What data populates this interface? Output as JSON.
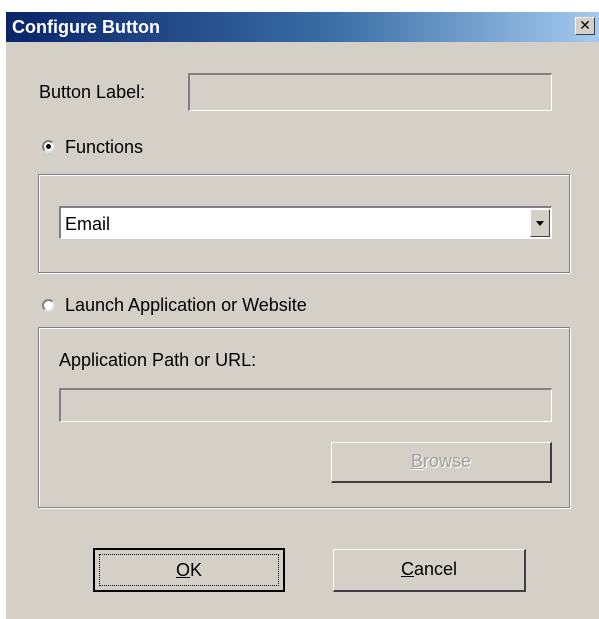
{
  "window": {
    "title": "Configure Button",
    "close_glyph": "✕"
  },
  "button_label": {
    "label": "Button Label:",
    "value": ""
  },
  "functions": {
    "radio_label": "Functions",
    "selected": true,
    "dropdown_value": "Email"
  },
  "launch": {
    "radio_label": "Launch Application or Website",
    "selected": false,
    "path_label": "Application Path or URL:",
    "path_value": "",
    "browse_label": "Browse"
  },
  "footer": {
    "ok_label": "OK",
    "cancel_label": "Cancel"
  }
}
